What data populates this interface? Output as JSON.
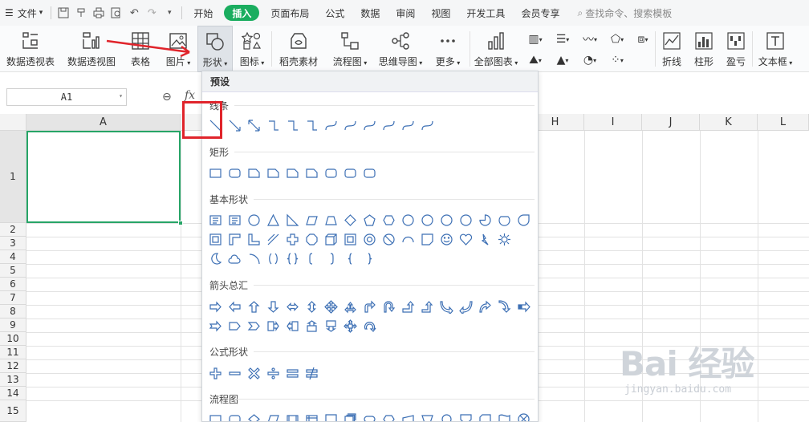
{
  "menubar": {
    "file_label": "文件",
    "tabs": [
      "开始",
      "插入",
      "页面布局",
      "公式",
      "数据",
      "审阅",
      "视图",
      "开发工具",
      "会员专享"
    ],
    "active_tab": "插入",
    "search_placeholder": "查找命令、搜索模板"
  },
  "ribbon": {
    "buttons": [
      {
        "label": "数据透视表",
        "icon": "pivot-table-icon"
      },
      {
        "label": "数据透视图",
        "icon": "pivot-chart-icon"
      },
      {
        "label": "表格",
        "icon": "table-icon"
      },
      {
        "label": "图片",
        "icon": "picture-icon"
      },
      {
        "label": "形状",
        "icon": "shapes-icon"
      },
      {
        "label": "图标",
        "icon": "icons-icon"
      },
      {
        "label": "稻壳素材",
        "icon": "docer-icon"
      },
      {
        "label": "流程图",
        "icon": "flowchart-icon"
      },
      {
        "label": "思维导图",
        "icon": "mindmap-icon"
      },
      {
        "label": "更多",
        "icon": "more-icon"
      },
      {
        "label": "全部图表",
        "icon": "all-charts-icon"
      },
      {
        "label": "折线",
        "icon": "sparkline-line-icon"
      },
      {
        "label": "柱形",
        "icon": "sparkline-column-icon"
      },
      {
        "label": "盈亏",
        "icon": "sparkline-winloss-icon"
      },
      {
        "label": "文本框",
        "icon": "textbox-icon"
      }
    ]
  },
  "formula": {
    "namebox_value": "A1",
    "fx_label": "fx"
  },
  "sheet": {
    "columns": [
      "A",
      "H",
      "I",
      "J",
      "K",
      "L"
    ],
    "rows": [
      "1",
      "2",
      "3",
      "4",
      "5",
      "6",
      "7",
      "8",
      "9",
      "10",
      "11",
      "12",
      "13",
      "14",
      "15"
    ]
  },
  "shapes_panel": {
    "title": "预设",
    "sections": {
      "lines": "线条",
      "rectangles": "矩形",
      "basic": "基本形状",
      "arrows": "箭头总汇",
      "equation": "公式形状",
      "flowchart": "流程图"
    }
  },
  "watermark": {
    "logo_text": "Bai 经验",
    "url_text": "jingyan.baidu.com"
  },
  "colors": {
    "active_tab": "#1aad5f",
    "selection": "#27a567",
    "annotation": "#e0242b",
    "shape_stroke": "#3c6fb4"
  }
}
